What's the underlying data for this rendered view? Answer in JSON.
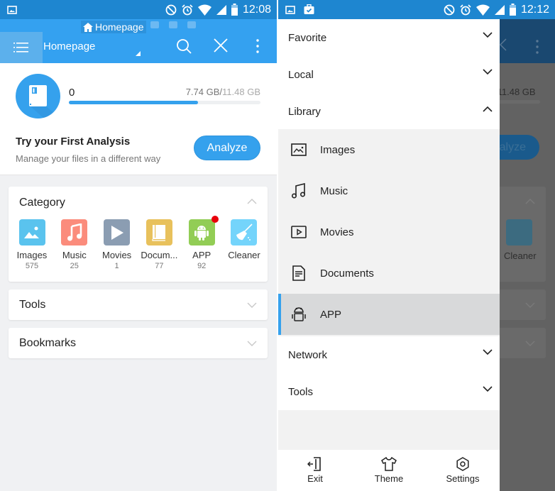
{
  "left_screen": {
    "status_bar": {
      "time": "12:08",
      "icons": [
        "image-icon",
        "do-not-disturb-icon",
        "alarm-icon",
        "wifi-icon",
        "signal-icon",
        "battery-icon"
      ]
    },
    "breadcrumb": {
      "label": "Homepage",
      "icon": "home-icon"
    },
    "breadcrumb_icons": [
      "chat-icon",
      "android-icon",
      "wifi-display-icon"
    ],
    "appbar": {
      "title": "Homepage",
      "actions": [
        "search-icon",
        "close-icon",
        "more-vert-icon"
      ]
    },
    "storage": {
      "used_count": "0",
      "used": "7.74 GB",
      "separator": "/",
      "total": "11.48 GB",
      "progress_fraction": 0.674,
      "title": "Try your First Analysis",
      "subtitle": "Manage your files in a different way",
      "button_label": "Analyze"
    },
    "category": {
      "title": "Category",
      "items": [
        {
          "label": "Images",
          "count": "575",
          "color": "#5ac3ee",
          "icon": "image-icon"
        },
        {
          "label": "Music",
          "count": "25",
          "color": "#fb8c7c",
          "icon": "music-note-icon"
        },
        {
          "label": "Movies",
          "count": "1",
          "color": "#8b9db2",
          "icon": "play-icon"
        },
        {
          "label": "Docum...",
          "count": "77",
          "color": "#e8c15c",
          "icon": "book-icon"
        },
        {
          "label": "APP",
          "count": "92",
          "color": "#92cd55",
          "icon": "android-icon",
          "badge": true
        },
        {
          "label": "Cleaner",
          "count": "",
          "color": "#74d4fb",
          "icon": "broom-icon"
        }
      ]
    },
    "tools": {
      "title": "Tools"
    },
    "bookmarks": {
      "title": "Bookmarks"
    }
  },
  "right_screen": {
    "status_bar": {
      "time": "12:12",
      "icons": [
        "image-icon",
        "briefcase-check-icon",
        "do-not-disturb-icon",
        "alarm-icon",
        "wifi-icon",
        "signal-icon",
        "battery-icon"
      ]
    },
    "background": {
      "storage_total": "/11.48 GB",
      "analyze_partial": "alyze",
      "cleaner_label": "Cleaner"
    },
    "drawer": {
      "sections": [
        {
          "label": "Favorite",
          "expanded": false
        },
        {
          "label": "Local",
          "expanded": false
        },
        {
          "label": "Library",
          "expanded": true
        }
      ],
      "library_items": [
        {
          "label": "Images",
          "icon": "image-outline-icon",
          "active": false
        },
        {
          "label": "Music",
          "icon": "music-note-outline-icon",
          "active": false
        },
        {
          "label": "Movies",
          "icon": "video-outline-icon",
          "active": false
        },
        {
          "label": "Documents",
          "icon": "document-outline-icon",
          "active": false
        },
        {
          "label": "APP",
          "icon": "android-outline-icon",
          "active": true
        }
      ],
      "sections_after": [
        {
          "label": "Network",
          "expanded": false
        },
        {
          "label": "Tools",
          "expanded": false
        }
      ],
      "bottom_actions": [
        {
          "label": "Exit",
          "icon": "exit-icon"
        },
        {
          "label": "Theme",
          "icon": "tshirt-icon"
        },
        {
          "label": "Settings",
          "icon": "settings-icon"
        }
      ]
    }
  },
  "colors": {
    "primary": "#34a1f0",
    "status_bar": "#1e86d0",
    "accent": "#35a1ed",
    "badge": "#e8000b"
  }
}
